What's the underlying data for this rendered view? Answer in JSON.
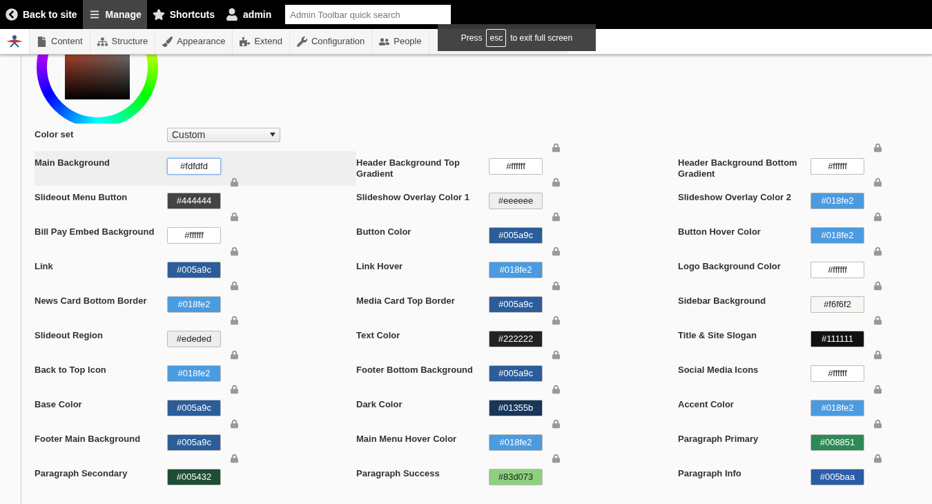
{
  "admin_toolbar": {
    "items": [
      {
        "label": "Back to site",
        "selected": false
      },
      {
        "label": "Manage",
        "selected": true
      },
      {
        "label": "Shortcuts",
        "selected": false
      },
      {
        "label": "admin",
        "selected": false
      }
    ],
    "search": {
      "placeholder": "Admin Toolbar quick search"
    }
  },
  "menu_bar": {
    "items": [
      {
        "label": "Content"
      },
      {
        "label": "Structure"
      },
      {
        "label": "Appearance"
      },
      {
        "label": "Extend"
      },
      {
        "label": "Configuration"
      },
      {
        "label": "People"
      }
    ]
  },
  "fullscreen_notice": {
    "before": "Press",
    "key": "esc",
    "after": "to exit full screen"
  },
  "color_set": {
    "label": "Color set",
    "value": "Custom"
  },
  "fields": [
    {
      "label": "Main Background",
      "value": "#fdfdfd",
      "color": "#fdfdfd",
      "focused": true,
      "lock": false
    },
    {
      "label": "Header Background Top Gradient",
      "value": "#ffffff",
      "color": "#ffffff",
      "focused": false,
      "lock": true
    },
    {
      "label": "Header Background Bottom Gradient",
      "value": "#ffffff",
      "color": "#ffffff",
      "focused": false,
      "lock": true
    },
    {
      "label": "Slideout Menu Button",
      "value": "#444444",
      "color": "#444444",
      "focused": false,
      "lock": true
    },
    {
      "label": "Slideshow Overlay Color 1",
      "value": "#eeeeee",
      "color": "#eeeeee",
      "focused": false,
      "lock": true
    },
    {
      "label": "Slideshow Overlay Color 2",
      "value": "#018fe2",
      "color": "#4a9be0",
      "focused": false,
      "lock": true
    },
    {
      "label": "Bill Pay Embed Background",
      "value": "#ffffff",
      "color": "#ffffff",
      "focused": false,
      "lock": true
    },
    {
      "label": "Button Color",
      "value": "#005a9c",
      "color": "#2a5d9a",
      "focused": false,
      "lock": true
    },
    {
      "label": "Button Hover Color",
      "value": "#018fe2",
      "color": "#4a9be0",
      "focused": false,
      "lock": true
    },
    {
      "label": "Link",
      "value": "#005a9c",
      "color": "#2a5d9a",
      "focused": false,
      "lock": true
    },
    {
      "label": "Link Hover",
      "value": "#018fe2",
      "color": "#4a9be0",
      "focused": false,
      "lock": true
    },
    {
      "label": "Logo Background Color",
      "value": "#ffffff",
      "color": "#ffffff",
      "focused": false,
      "lock": true
    },
    {
      "label": "News Card Bottom Border",
      "value": "#018fe2",
      "color": "#4a9be0",
      "focused": false,
      "lock": true
    },
    {
      "label": "Media Card Top Border",
      "value": "#005a9c",
      "color": "#2a5d9a",
      "focused": false,
      "lock": true
    },
    {
      "label": "Sidebar Background",
      "value": "#f6f6f2",
      "color": "#f6f6f2",
      "focused": false,
      "lock": true
    },
    {
      "label": "Slideout Region",
      "value": "#ededed",
      "color": "#ededed",
      "focused": false,
      "lock": true
    },
    {
      "label": "Text Color",
      "value": "#222222",
      "color": "#222222",
      "focused": false,
      "lock": true
    },
    {
      "label": "Title & Site Slogan",
      "value": "#111111",
      "color": "#111111",
      "focused": false,
      "lock": true
    },
    {
      "label": "Back to Top Icon",
      "value": "#018fe2",
      "color": "#4a9be0",
      "focused": false,
      "lock": true
    },
    {
      "label": "Footer Bottom Background",
      "value": "#005a9c",
      "color": "#2a5d9a",
      "focused": false,
      "lock": true
    },
    {
      "label": "Social Media Icons",
      "value": "#ffffff",
      "color": "#ffffff",
      "focused": false,
      "lock": true
    },
    {
      "label": "Base Color",
      "value": "#005a9c",
      "color": "#2a5d9a",
      "focused": false,
      "lock": true
    },
    {
      "label": "Dark Color",
      "value": "#01355b",
      "color": "#17365a",
      "focused": false,
      "lock": true
    },
    {
      "label": "Accent Color",
      "value": "#018fe2",
      "color": "#4a9be0",
      "focused": false,
      "lock": true
    },
    {
      "label": "Footer Main Background",
      "value": "#005a9c",
      "color": "#2a5d9a",
      "focused": false,
      "lock": true
    },
    {
      "label": "Main Menu Hover Color",
      "value": "#018fe2",
      "color": "#4a9be0",
      "focused": false,
      "lock": true
    },
    {
      "label": "Paragraph Primary",
      "value": "#008851",
      "color": "#2e8a55",
      "focused": false,
      "lock": true
    },
    {
      "label": "Paragraph Secondary",
      "value": "#005432",
      "color": "#1d4d33",
      "focused": false,
      "lock": true
    },
    {
      "label": "Paragraph Success",
      "value": "#83d073",
      "color": "#8fd07f",
      "focused": false,
      "lock": true
    },
    {
      "label": "Paragraph Info",
      "value": "#005baa",
      "color": "#2a5ca8",
      "focused": false,
      "lock": true
    }
  ]
}
